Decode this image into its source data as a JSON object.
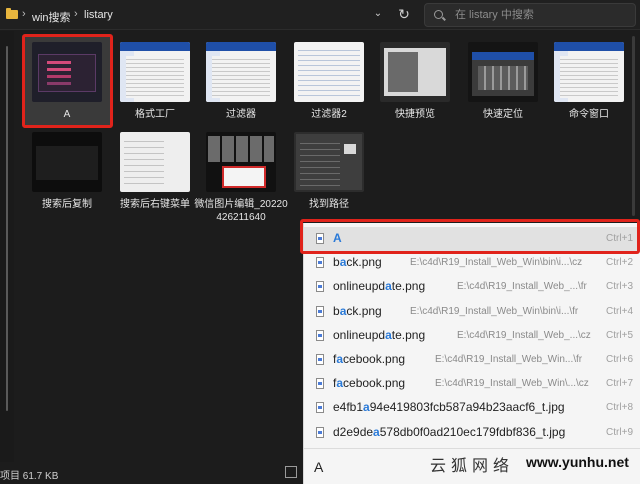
{
  "breadcrumb": {
    "items": [
      "win搜索",
      "listary"
    ]
  },
  "search": {
    "placeholder": "在 listary 中搜索"
  },
  "files": [
    {
      "label": "A",
      "thumb": "dark-app",
      "selected": true
    },
    {
      "label": "格式工厂",
      "thumb": "light-window"
    },
    {
      "label": "过滤器",
      "thumb": "light-window"
    },
    {
      "label": "过滤器2",
      "thumb": "light-list"
    },
    {
      "label": "快捷预览",
      "thumb": "grey-window"
    },
    {
      "label": "快速定位",
      "thumb": "mixed-window"
    },
    {
      "label": "命令窗口",
      "thumb": "light-window"
    },
    {
      "label": "搜索后复制",
      "thumb": "black-window"
    },
    {
      "label": "搜索后右键菜单",
      "thumb": "context-menu"
    },
    {
      "label": "微信图片编辑_20220426211640",
      "thumb": "photo-edit"
    },
    {
      "label": "找到路径",
      "thumb": "dark-dialog"
    }
  ],
  "status": {
    "text": "项目 61.7 KB"
  },
  "listary": {
    "query": "A",
    "results": [
      {
        "pre": "",
        "hl": "A",
        "post": "",
        "path": "",
        "shortcut": "Ctrl+1"
      },
      {
        "pre": "b",
        "hl": "a",
        "post": "ck.png",
        "path": "E:\\c4d\\R19_Install_Web_Win\\bin\\i...\\cz",
        "shortcut": "Ctrl+2"
      },
      {
        "pre": "onlineupd",
        "hl": "a",
        "post": "te.png",
        "path": "E:\\c4d\\R19_Install_Web_...\\fr",
        "shortcut": "Ctrl+3"
      },
      {
        "pre": "b",
        "hl": "a",
        "post": "ck.png",
        "path": "E:\\c4d\\R19_Install_Web_Win\\bin\\i...\\fr",
        "shortcut": "Ctrl+4"
      },
      {
        "pre": "onlineupd",
        "hl": "a",
        "post": "te.png",
        "path": "E:\\c4d\\R19_Install_Web_...\\cz",
        "shortcut": "Ctrl+5"
      },
      {
        "pre": "f",
        "hl": "a",
        "post": "cebook.png",
        "path": "E:\\c4d\\R19_Install_Web_Win...\\fr",
        "shortcut": "Ctrl+6"
      },
      {
        "pre": "f",
        "hl": "a",
        "post": "cebook.png",
        "path": "E:\\c4d\\R19_Install_Web_Win\\...\\cz",
        "shortcut": "Ctrl+7"
      },
      {
        "pre": "e4fb1",
        "hl": "a",
        "post": "94e419803fcb587a94b23aacf6_t.jpg",
        "path": "",
        "shortcut": "Ctrl+8"
      },
      {
        "pre": "d2e9de",
        "hl": "a",
        "post": "578db0f0ad210ec179fdbf836_t.jpg",
        "path": "",
        "shortcut": "Ctrl+9"
      }
    ]
  },
  "watermark": {
    "cn": "云狐网络",
    "url": "www.yunhu.net"
  }
}
